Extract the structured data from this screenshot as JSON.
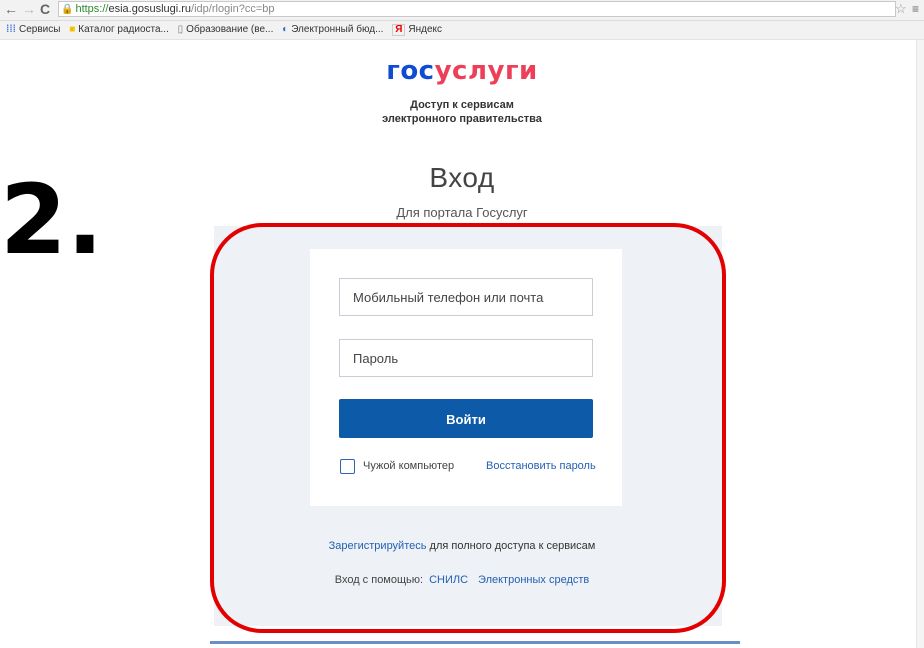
{
  "browser": {
    "nav": {
      "back_icon": "←",
      "forward_icon": "→",
      "reload_icon": "C"
    },
    "url": {
      "scheme": "https://",
      "host": "esia.gosuslugi.ru",
      "path": "/idp/rlogin?cc=bp"
    },
    "star_icon": "☆",
    "menu_icon": "≡",
    "bookmarks": [
      {
        "label": "Сервисы",
        "icon": "apps-icon"
      },
      {
        "label": "Каталог радиоста...",
        "icon": "folder-icon"
      },
      {
        "label": "Образование (ве...",
        "icon": "page-icon"
      },
      {
        "label": "Электронный бюд...",
        "icon": "edu-icon"
      },
      {
        "label": "Яндекс",
        "icon": "yandex-icon"
      }
    ]
  },
  "logo": {
    "part1": "гос",
    "part2": "услуги",
    "colors": {
      "blue": "#0d4cd3",
      "red": "#ee3f58"
    }
  },
  "tagline": {
    "line1": "Доступ к сервисам",
    "line2": "электронного правительства"
  },
  "heading": {
    "title": "Вход",
    "subtitle": "Для портала Госуслуг"
  },
  "annotation": {
    "number": "2."
  },
  "form": {
    "login_placeholder": "Мобильный телефон или почта",
    "password_placeholder": "Пароль",
    "submit_label": "Войти",
    "checkbox_label": "Чужой компьютер",
    "restore_label": "Восстановить пароль"
  },
  "register": {
    "link": "Зарегистрируйтесь",
    "rest": " для полного доступа к сервисам"
  },
  "via": {
    "label": "Вход с помощью:",
    "snils": "СНИЛС",
    "electronic": "Электронных средств"
  },
  "colors": {
    "primary_button": "#0c5aa8",
    "link": "#2460b3",
    "highlight": "#e30000"
  }
}
